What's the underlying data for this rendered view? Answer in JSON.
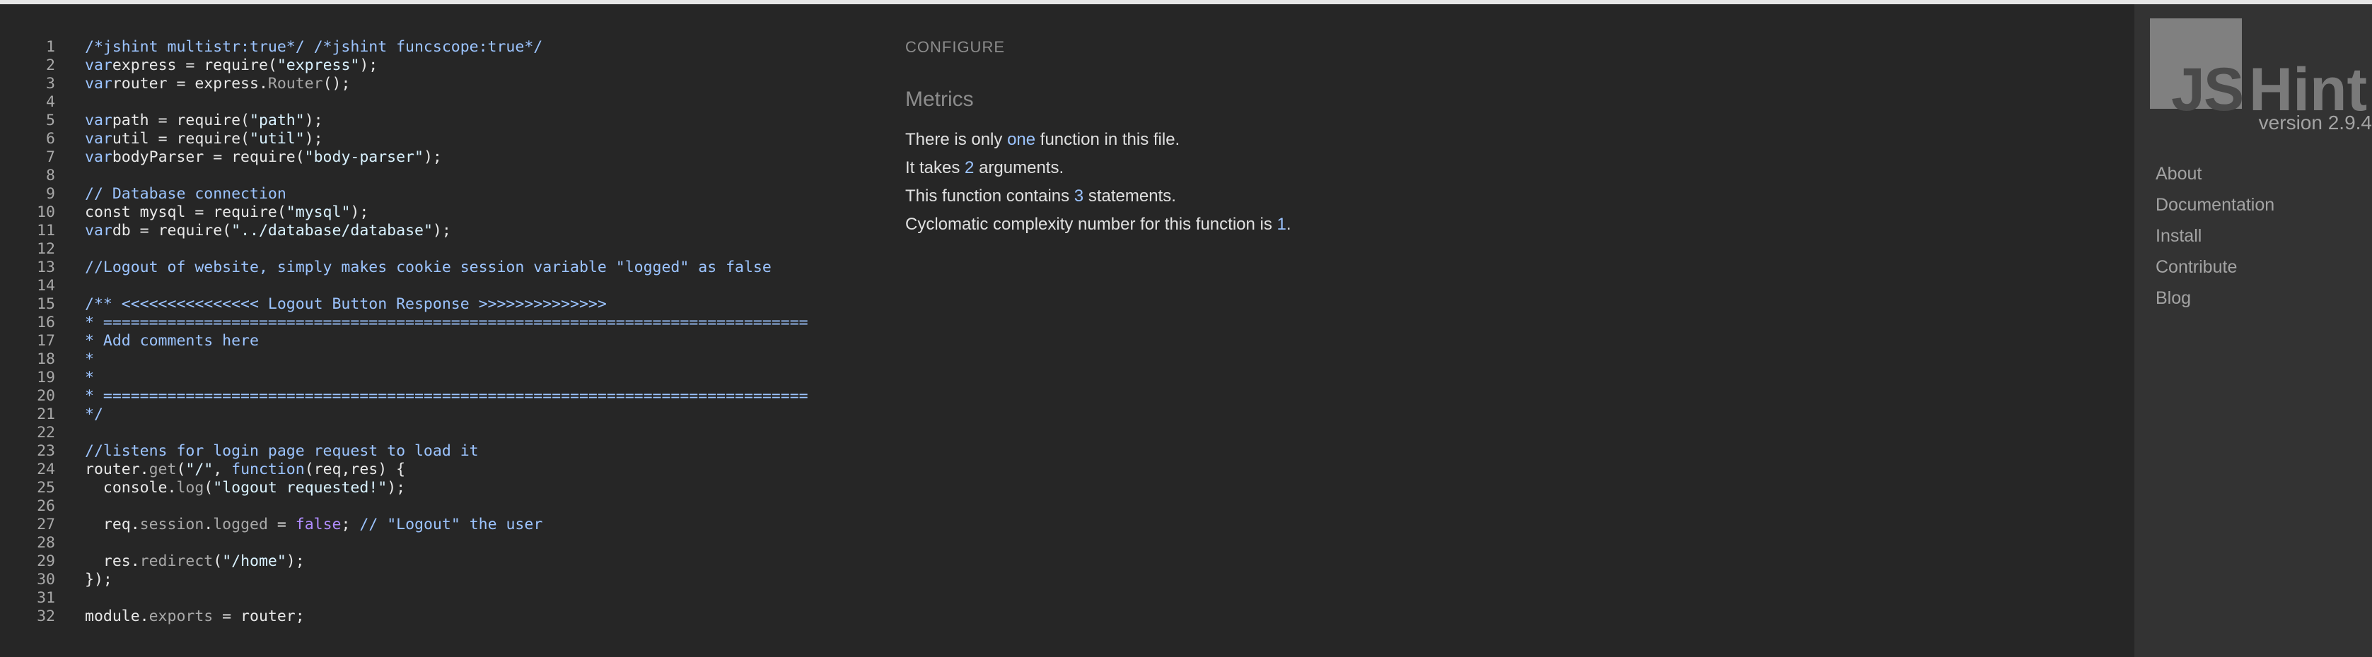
{
  "editor": {
    "lines": [
      {
        "n": "1",
        "segs": [
          [
            "c-comment",
            "/*jshint multistr:true*/ /*jshint funcscope:true*/"
          ]
        ]
      },
      {
        "n": "2",
        "segs": [
          [
            "c-kw",
            "var"
          ],
          [
            "",
            "express = require("
          ],
          [
            "c-str",
            "\"express\""
          ],
          [
            "",
            "); "
          ]
        ]
      },
      {
        "n": "3",
        "segs": [
          [
            "c-kw",
            "var"
          ],
          [
            "",
            "router = express."
          ],
          [
            "c-prop",
            "Router"
          ],
          [
            "",
            "();"
          ]
        ]
      },
      {
        "n": "4",
        "segs": []
      },
      {
        "n": "5",
        "segs": [
          [
            "c-kw",
            "var"
          ],
          [
            "",
            "path = require("
          ],
          [
            "c-str",
            "\"path\""
          ],
          [
            "",
            ");"
          ]
        ]
      },
      {
        "n": "6",
        "segs": [
          [
            "c-kw",
            "var"
          ],
          [
            "",
            "util = require("
          ],
          [
            "c-str",
            "\"util\""
          ],
          [
            "",
            ");"
          ]
        ]
      },
      {
        "n": "7",
        "segs": [
          [
            "c-kw",
            "var"
          ],
          [
            "",
            "bodyParser = require("
          ],
          [
            "c-str",
            "\"body-parser\""
          ],
          [
            "",
            ");"
          ]
        ]
      },
      {
        "n": "8",
        "segs": []
      },
      {
        "n": "9",
        "segs": [
          [
            "c-comment",
            "// Database connection"
          ]
        ]
      },
      {
        "n": "10",
        "segs": [
          [
            "",
            "const mysql = require("
          ],
          [
            "c-str",
            "\"mysql\""
          ],
          [
            "",
            ");"
          ]
        ]
      },
      {
        "n": "11",
        "segs": [
          [
            "c-kw",
            "var"
          ],
          [
            "",
            "db = require("
          ],
          [
            "c-str",
            "\"../database/database\""
          ],
          [
            "",
            ");"
          ]
        ]
      },
      {
        "n": "12",
        "segs": []
      },
      {
        "n": "13",
        "segs": [
          [
            "c-comment",
            "//Logout of website, simply makes cookie session variable \"logged\" as false"
          ]
        ]
      },
      {
        "n": "14",
        "segs": []
      },
      {
        "n": "15",
        "segs": [
          [
            "c-comment",
            "/** <<<<<<<<<<<<<<< Logout Button Response >>>>>>>>>>>>>>"
          ]
        ]
      },
      {
        "n": "16",
        "segs": [
          [
            "c-comment",
            "* ============================================================================="
          ]
        ]
      },
      {
        "n": "17",
        "segs": [
          [
            "c-comment",
            "* Add comments here"
          ]
        ]
      },
      {
        "n": "18",
        "segs": [
          [
            "c-comment",
            "*"
          ]
        ]
      },
      {
        "n": "19",
        "segs": [
          [
            "c-comment",
            "*"
          ]
        ]
      },
      {
        "n": "20",
        "segs": [
          [
            "c-comment",
            "* ============================================================================="
          ]
        ]
      },
      {
        "n": "21",
        "segs": [
          [
            "c-comment",
            "*/"
          ]
        ]
      },
      {
        "n": "22",
        "segs": []
      },
      {
        "n": "23",
        "segs": [
          [
            "c-comment",
            "//listens for login page request to load it"
          ]
        ]
      },
      {
        "n": "24",
        "segs": [
          [
            "",
            "router."
          ],
          [
            "c-prop",
            "get"
          ],
          [
            "",
            "("
          ],
          [
            "c-str",
            "\"/\""
          ],
          [
            "",
            ", "
          ],
          [
            "c-kw",
            "function"
          ],
          [
            "",
            "(req,res) {"
          ]
        ]
      },
      {
        "n": "25",
        "segs": [
          [
            "",
            "  console."
          ],
          [
            "c-prop",
            "log"
          ],
          [
            "",
            "("
          ],
          [
            "c-str",
            "\"logout requested!\""
          ],
          [
            "",
            ");"
          ]
        ]
      },
      {
        "n": "26",
        "segs": []
      },
      {
        "n": "27",
        "segs": [
          [
            "",
            "  req."
          ],
          [
            "c-prop",
            "session"
          ],
          [
            "",
            "."
          ],
          [
            "c-prop",
            "logged"
          ],
          [
            "",
            " = "
          ],
          [
            "c-false",
            "false"
          ],
          [
            "",
            "; "
          ],
          [
            "c-comment",
            "// \"Logout\" the user"
          ]
        ]
      },
      {
        "n": "28",
        "segs": []
      },
      {
        "n": "29",
        "segs": [
          [
            "",
            "  res."
          ],
          [
            "c-prop",
            "redirect"
          ],
          [
            "",
            "("
          ],
          [
            "c-str",
            "\"/home\""
          ],
          [
            "",
            ");"
          ]
        ]
      },
      {
        "n": "30",
        "segs": [
          [
            "",
            "});"
          ]
        ]
      },
      {
        "n": "31",
        "segs": []
      },
      {
        "n": "32",
        "segs": [
          [
            "",
            "module."
          ],
          [
            "c-prop",
            "exports"
          ],
          [
            "",
            " = router;"
          ]
        ]
      }
    ]
  },
  "report": {
    "configure_label": "CONFIGURE",
    "metrics_title": "Metrics",
    "metrics": [
      [
        [
          "",
          "There is only "
        ],
        [
          "hl",
          "one"
        ],
        [
          "",
          " function in this file."
        ]
      ],
      [
        [
          "",
          "It takes "
        ],
        [
          "hl",
          "2"
        ],
        [
          "",
          " arguments."
        ]
      ],
      [
        [
          "",
          "This function contains "
        ],
        [
          "hl",
          "3"
        ],
        [
          "",
          " statements."
        ]
      ],
      [
        [
          "",
          "Cyclomatic complexity number for this function is "
        ],
        [
          "hl",
          "1"
        ],
        [
          "",
          "."
        ]
      ]
    ]
  },
  "sidebar": {
    "logo_js": "JS",
    "logo_hint": "Hint",
    "version": "version 2.9.4",
    "nav": [
      "About",
      "Documentation",
      "Install",
      "Contribute",
      "Blog"
    ]
  }
}
